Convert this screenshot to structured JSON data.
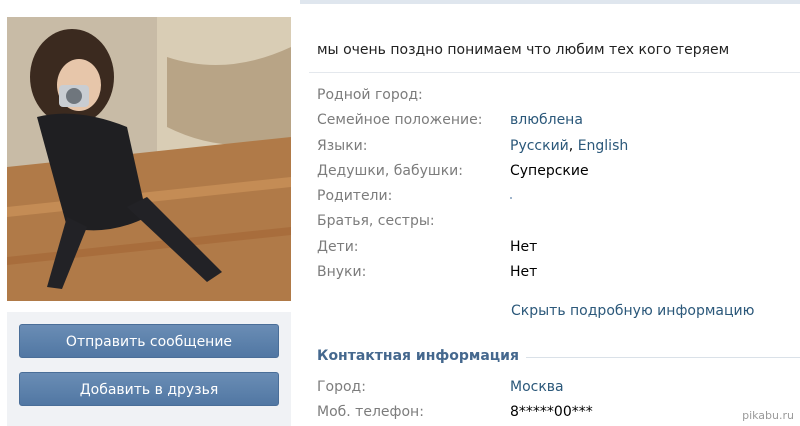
{
  "status": "мы очень поздно понимаем что любим тех кого теряем",
  "info_rows": [
    {
      "label": "Родной город:",
      "value": ""
    },
    {
      "label": "Семейное положение:",
      "value": "влюблена"
    },
    {
      "label": "Языки:",
      "lang1": "Русский",
      "sep": ", ",
      "lang2": "English"
    },
    {
      "label": "Дедушки, бабушки:",
      "value": "Суперские"
    },
    {
      "label": "Родители:",
      "value": ""
    },
    {
      "label": "Братья, сестры:",
      "value": ""
    },
    {
      "label": "Дети:",
      "value": "Нет"
    },
    {
      "label": "Внуки:",
      "value": "Нет"
    }
  ],
  "hide_link": "Скрыть подробную информацию",
  "contact": {
    "title": "Контактная информация",
    "city_label": "Город:",
    "city_value": "Москва",
    "phone_label": "Моб. телефон:",
    "phone_value": "8*****00***"
  },
  "buttons": {
    "send_message": "Отправить сообщение",
    "add_friend": "Добавить в друзья"
  },
  "watermark": "pikabu.ru",
  "colors": {
    "link": "#2b587a",
    "button": "#5b80ab",
    "section_title": "#45688e",
    "label": "#7c7c7c"
  }
}
